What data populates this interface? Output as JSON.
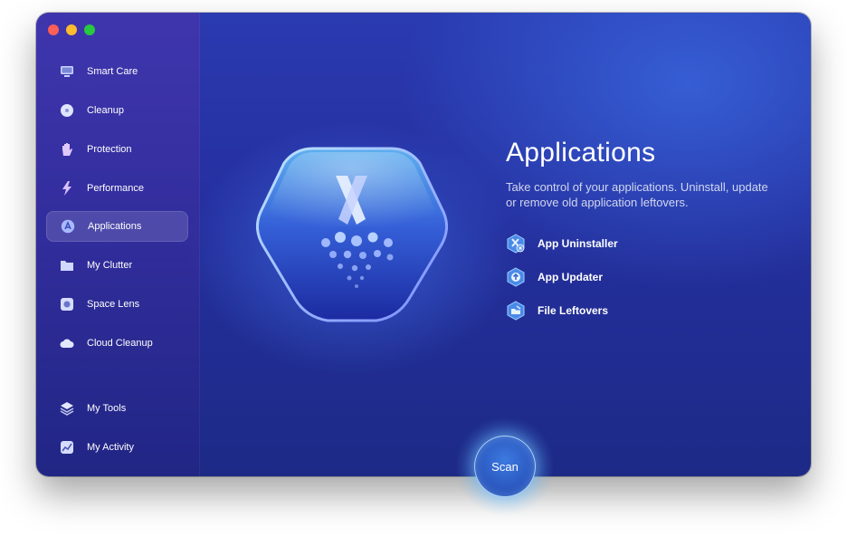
{
  "sidebar": {
    "items": [
      {
        "label": "Smart Care",
        "icon": "monitor-icon"
      },
      {
        "label": "Cleanup",
        "icon": "disk-icon"
      },
      {
        "label": "Protection",
        "icon": "hand-icon"
      },
      {
        "label": "Performance",
        "icon": "bolt-icon"
      },
      {
        "label": "Applications",
        "icon": "app-store-icon",
        "active": true
      },
      {
        "label": "My Clutter",
        "icon": "folder-icon"
      },
      {
        "label": "Space Lens",
        "icon": "lens-icon"
      },
      {
        "label": "Cloud Cleanup",
        "icon": "cloud-icon"
      }
    ],
    "bottom_items": [
      {
        "label": "My Tools",
        "icon": "layers-icon"
      },
      {
        "label": "My Activity",
        "icon": "activity-chart-icon"
      }
    ]
  },
  "main": {
    "title": "Applications",
    "description": "Take control of your applications. Uninstall, update or remove old application leftovers.",
    "features": [
      {
        "label": "App Uninstaller",
        "icon": "uninstaller-icon"
      },
      {
        "label": "App Updater",
        "icon": "updater-icon"
      },
      {
        "label": "File Leftovers",
        "icon": "leftovers-icon"
      }
    ]
  },
  "scan_button": {
    "label": "Scan"
  },
  "colors": {
    "accent": "#2a58c0",
    "background_top": "#2a3ab0",
    "background_bottom": "#1d2a86"
  }
}
